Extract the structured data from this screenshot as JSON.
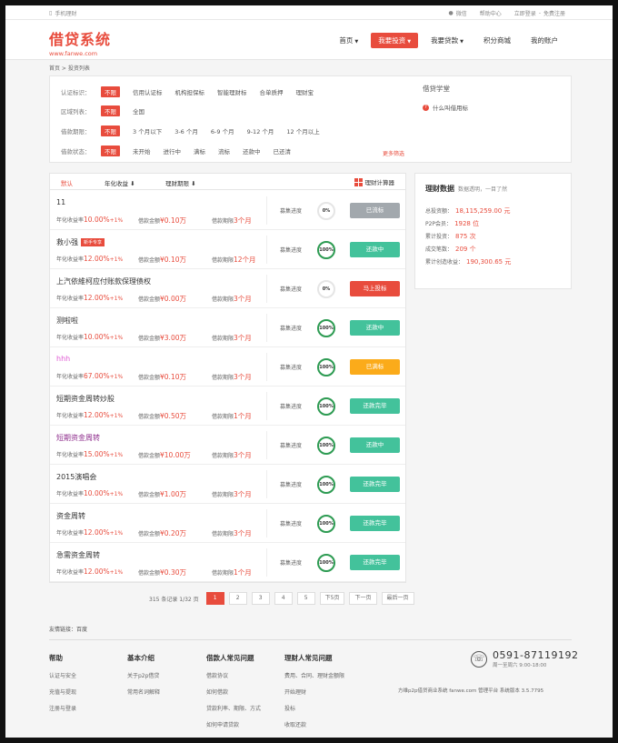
{
  "topbar": {
    "mobile": "手机理财",
    "wechat": "微信",
    "help": "帮助中心",
    "login": "立即登录",
    "sep": "-",
    "register": "免费注册"
  },
  "brand": {
    "name": "借贷系统",
    "url": "www.fanwe.com",
    "color": "#e84c3d"
  },
  "nav": [
    {
      "label": "首页",
      "caret": true,
      "active": false
    },
    {
      "label": "我要投资",
      "caret": true,
      "active": true
    },
    {
      "label": "我要贷款",
      "caret": true,
      "active": false
    },
    {
      "label": "积分商城",
      "caret": false,
      "active": false
    },
    {
      "label": "我的账户",
      "caret": false,
      "active": false
    }
  ],
  "breadcrumb": "首页 > 投资列表",
  "filters": [
    {
      "label": "认证标识：",
      "options": [
        "不限",
        "信用认证标",
        "机构担保标",
        "智能理财标",
        "合单质押",
        "理财宝"
      ]
    },
    {
      "label": "区域列表：",
      "options": [
        "不限",
        "全国"
      ]
    },
    {
      "label": "借款期限：",
      "options": [
        "不限",
        "3 个月以下",
        "3-6 个月",
        "6-9 个月",
        "9-12 个月",
        "12 个月以上"
      ]
    },
    {
      "label": "借款状态：",
      "options": [
        "不限",
        "未开始",
        "进行中",
        "满标",
        "流标",
        "还款中",
        "已还清"
      ]
    }
  ],
  "more_filter": "更多筛选",
  "learn": {
    "title": "借贷学堂",
    "question": "什么叫借用标",
    "q_icon": "?"
  },
  "sortbar": {
    "default": "默认",
    "rate": "年化收益",
    "period": "理财期限",
    "calc": "理财计算器"
  },
  "loan_labels": {
    "rate": "年化收益率",
    "amount": "借款金额",
    "period": "借款期限",
    "progress": "募集进度"
  },
  "loans": [
    {
      "name": "11",
      "name_color": "#333",
      "badge": "",
      "rate": "10.00%",
      "bonus": "+1%",
      "amount": "¥0.10万",
      "period": "3个月",
      "progress": "0%",
      "progress_value": 0,
      "action": "已流标",
      "state": "grey"
    },
    {
      "name": "救小强",
      "name_color": "#333",
      "badge": "新手专享",
      "rate": "12.00%",
      "bonus": "+1%",
      "amount": "¥0.10万",
      "period": "12个月",
      "progress": "100%",
      "progress_value": 100,
      "action": "还款中",
      "state": "green"
    },
    {
      "name": "上汽依維柯应付账款保理债权",
      "name_color": "#333",
      "badge": "",
      "rate": "12.00%",
      "bonus": "+1%",
      "amount": "¥0.00万",
      "period": "3个月",
      "progress": "0%",
      "progress_value": 0,
      "action": "马上投标",
      "state": "red"
    },
    {
      "name": "测啦啦",
      "name_color": "#333",
      "badge": "",
      "rate": "10.00%",
      "bonus": "+1%",
      "amount": "¥3.00万",
      "period": "3个月",
      "progress": "100%",
      "progress_value": 100,
      "action": "还款中",
      "state": "green"
    },
    {
      "name": "hhh",
      "name_color": "#e05cd4",
      "badge": "",
      "rate": "67.00%",
      "bonus": "+1%",
      "amount": "¥0.10万",
      "period": "3个月",
      "progress": "100%",
      "progress_value": 100,
      "action": "已满标",
      "state": "orange"
    },
    {
      "name": "短期资金周转炒股",
      "name_color": "#333",
      "badge": "",
      "rate": "12.00%",
      "bonus": "+1%",
      "amount": "¥0.50万",
      "period": "1个月",
      "progress": "100%",
      "progress_value": 100,
      "action": "还款完毕",
      "state": "green"
    },
    {
      "name": "短期资金周转",
      "name_color": "#8e2d8c",
      "badge": "",
      "rate": "15.00%",
      "bonus": "+1%",
      "amount": "¥10.00万",
      "period": "3个月",
      "progress": "100%",
      "progress_value": 100,
      "action": "还款中",
      "state": "green"
    },
    {
      "name": "2015演唱会",
      "name_color": "#333",
      "badge": "",
      "rate": "10.00%",
      "bonus": "+1%",
      "amount": "¥1.00万",
      "period": "3个月",
      "progress": "100%",
      "progress_value": 100,
      "action": "还款完毕",
      "state": "green"
    },
    {
      "name": "资金周转",
      "name_color": "#333",
      "badge": "",
      "rate": "12.00%",
      "bonus": "+1%",
      "amount": "¥0.20万",
      "period": "3个月",
      "progress": "100%",
      "progress_value": 100,
      "action": "还款完毕",
      "state": "green"
    },
    {
      "name": "急需资金周转",
      "name_color": "#333",
      "badge": "",
      "rate": "12.00%",
      "bonus": "+1%",
      "amount": "¥0.30万",
      "period": "1个月",
      "progress": "100%",
      "progress_value": 100,
      "action": "还款完毕",
      "state": "green"
    }
  ],
  "stats": {
    "title": "理财数据",
    "subtitle": "数据透明，一目了然",
    "lines": [
      {
        "label": "总投资额：",
        "value": "18,115,259.00 元"
      },
      {
        "label": "P2P会员：",
        "value": "1928 位"
      },
      {
        "label": "累计投资：",
        "value": "875 次"
      },
      {
        "label": "成交笔数：",
        "value": "209 个"
      },
      {
        "label": "累计创造收益：",
        "value": "190,300.65 元"
      }
    ]
  },
  "pager": {
    "info": "315 条记录 1/32 页",
    "pages": [
      "1",
      "2",
      "3",
      "4",
      "5"
    ],
    "current": "1",
    "next5": "下5页",
    "next": "下一页",
    "last": "最后一页"
  },
  "friend_links": "友情链接：百度",
  "footer": [
    {
      "title": "帮助",
      "items": [
        "认证与安全",
        "充值与提现",
        "注册与登录"
      ]
    },
    {
      "title": "基本介绍",
      "items": [
        "关于p2p借贷",
        "常用名词解释"
      ]
    },
    {
      "title": "借款人常见问题",
      "items": [
        "借款协议",
        "如何借款",
        "贷款利率、期限、方式",
        "如何申请贷款"
      ]
    },
    {
      "title": "理财人常见问题",
      "items": [
        "费用、合同、理财金额限",
        "开始理财",
        "投标",
        "收取还款"
      ]
    }
  ],
  "contact": {
    "phone": "0591-87119192",
    "hours": "周一至周六 9:00-18:00",
    "icon": "☏"
  },
  "copyright": "方维p2p借贷商业系统 fanwe.com 管理平台 系统版本 3.5.7795"
}
